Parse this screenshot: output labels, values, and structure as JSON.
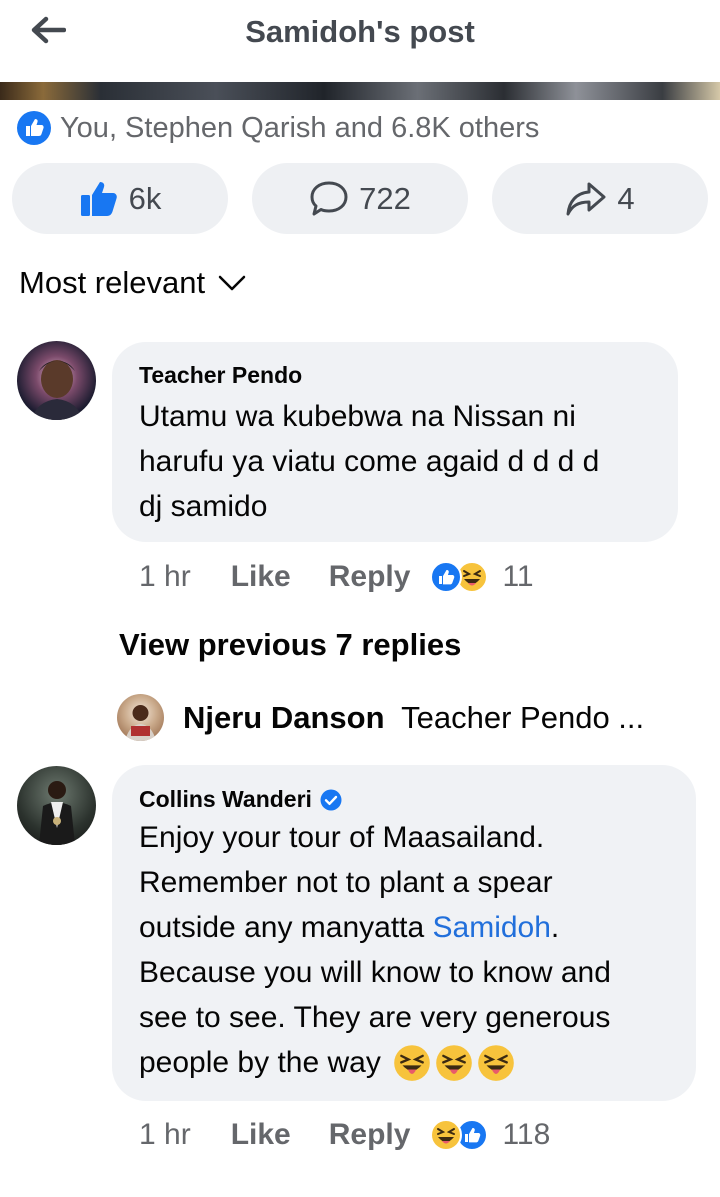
{
  "header": {
    "title": "Samidoh's post"
  },
  "summary": {
    "text": "You, Stephen Qarish and 6.8K others"
  },
  "actions": {
    "like_count": "6k",
    "comment_count": "722",
    "share_count": "4"
  },
  "sort": {
    "label": "Most relevant"
  },
  "comments": [
    {
      "author": "Teacher Pendo",
      "lines": [
        "Utamu wa kubebwa na Nissan ni",
        "harufu ya viatu come agaid d d d d",
        "dj samido"
      ],
      "time": "1 hr",
      "like_label": "Like",
      "reply_label": "Reply",
      "reaction_count": "11"
    },
    {
      "author": "Collins Wanderi",
      "lines": [
        "Enjoy your tour of Maasailand.",
        "Remember not to plant a spear",
        "outside any manyatta ",
        "Because you will know to know and",
        "see to see. They are very generous",
        "people by the way"
      ],
      "mention": "Samidoh",
      "mention_suffix": ".",
      "time": "1 hr",
      "like_label": "Like",
      "reply_label": "Reply",
      "reaction_count": "118"
    }
  ],
  "view_previous": "View previous 7 replies",
  "reply_preview": {
    "author": "Njeru Danson",
    "text": "Teacher Pendo ..."
  },
  "colors": {
    "accent": "#1877f2",
    "link": "#216fdb",
    "bubble": "#f0f2f5",
    "muted": "#65676b"
  },
  "icons": [
    "back-arrow-icon",
    "like-reaction-icon",
    "thumbs-up-icon",
    "comment-icon",
    "share-icon",
    "chevron-down-icon",
    "verified-badge-icon",
    "laughing-emoji-icon"
  ]
}
